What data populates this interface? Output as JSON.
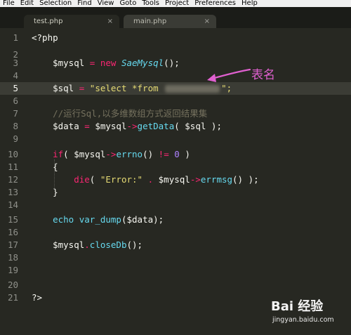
{
  "menu": [
    "File",
    "Edit",
    "Selection",
    "Find",
    "View",
    "Goto",
    "Tools",
    "Project",
    "Preferences",
    "Help"
  ],
  "tabs": [
    {
      "label": "test.php",
      "close": "×"
    },
    {
      "label": "main.php",
      "close": "×"
    }
  ],
  "gutter": {
    "lines": [
      "1",
      "2",
      "3",
      "4",
      "5",
      "6",
      "7",
      "8",
      "9",
      "10",
      "11",
      "12",
      "13",
      "14",
      "15",
      "16",
      "17",
      "18",
      "19",
      "20",
      "21"
    ]
  },
  "code": {
    "l1": "<?php",
    "l3": {
      "var": "$mysql",
      "op1": " = ",
      "new": "new",
      "cls": "SaeMysql",
      "end": "();"
    },
    "l5": {
      "var": "$sql",
      "op": " = ",
      "str": "\"select *from ",
      "strend": "\";"
    },
    "l7": "//运行Sql,以多维数组方式返回结果集",
    "l8": {
      "var": "$data",
      "op": " = ",
      "obj": "$mysql",
      "arrow": "->",
      "fn": "getData",
      "args": "( $sql );"
    },
    "l10": {
      "kw": "if",
      "p1": "( ",
      "obj": "$mysql",
      "arrow": "->",
      "fn": "errno",
      "p2": "() ",
      "op": "!=",
      "sp": " ",
      "num": "0",
      "p3": " )"
    },
    "l11": "{",
    "l12": {
      "kw": "die",
      "p1": "( ",
      "str": "\"Error:\"",
      "dot": " . ",
      "obj": "$mysql",
      "arrow": "->",
      "fn": "errmsg",
      "p2": "() );"
    },
    "l13": "}",
    "l15": {
      "fn1": "echo",
      "sp": " ",
      "fn2": "var_dump",
      "args": "($data);"
    },
    "l17": {
      "obj": "$mysql",
      "dot": ".",
      "fn": "closeDb",
      "end": "();"
    },
    "l21": "?>"
  },
  "annotation": "表名",
  "watermark": {
    "logo": "Bai 经验",
    "sub": "jingyan.baidu.com"
  },
  "colors": {
    "background": "#272822",
    "keyword": "#f92672",
    "function": "#66d9ef",
    "string": "#e6db74",
    "number": "#ae81ff",
    "comment": "#75715e",
    "annotation": "#e060d0"
  }
}
